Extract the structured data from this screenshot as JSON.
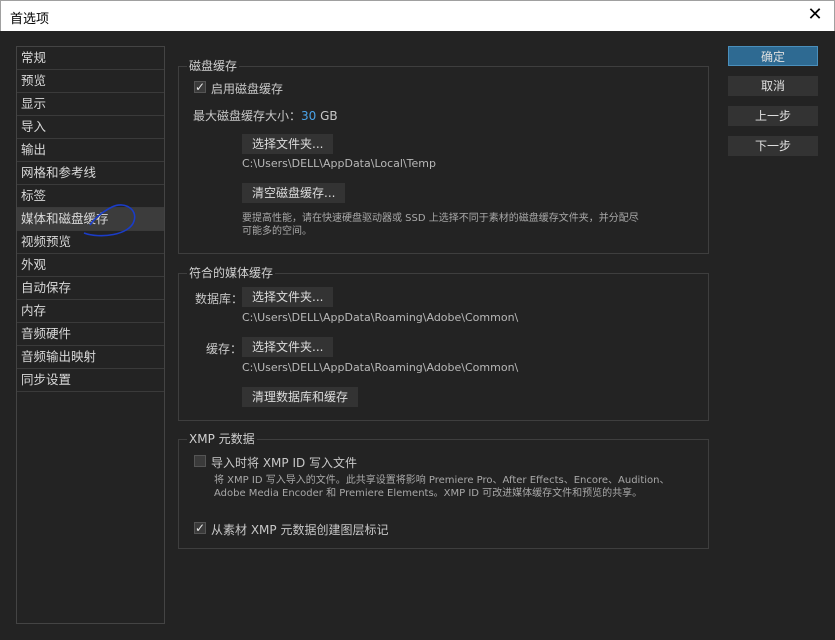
{
  "window": {
    "title": "首选项"
  },
  "sidebar": {
    "items": [
      {
        "label": "常规"
      },
      {
        "label": "预览"
      },
      {
        "label": "显示"
      },
      {
        "label": "导入"
      },
      {
        "label": "输出"
      },
      {
        "label": "网格和参考线"
      },
      {
        "label": "标签"
      },
      {
        "label": "媒体和磁盘缓存"
      },
      {
        "label": "视频预览"
      },
      {
        "label": "外观"
      },
      {
        "label": "自动保存"
      },
      {
        "label": "内存"
      },
      {
        "label": "音频硬件"
      },
      {
        "label": "音频输出映射"
      },
      {
        "label": "同步设置"
      }
    ],
    "selected_index": 7
  },
  "disk_cache": {
    "title": "磁盘缓存",
    "enable_label": "启用磁盘缓存",
    "enabled": true,
    "max_size_label": "最大磁盘缓存大小：",
    "max_size_value": "30",
    "max_size_unit": "GB",
    "choose_folder_label": "选择文件夹...",
    "path": "C:\\Users\\DELL\\AppData\\Local\\Temp",
    "clear_label": "清空磁盘缓存...",
    "note_line1": "要提高性能，请在快速硬盘驱动器或 SSD 上选择不同于素材的磁盘缓存文件夹，并分配尽",
    "note_line2": "可能多的空间。"
  },
  "media_cache": {
    "title": "符合的媒体缓存",
    "database_label": "数据库：",
    "database_button": "选择文件夹...",
    "database_path": "C:\\Users\\DELL\\AppData\\Roaming\\Adobe\\Common\\",
    "cache_label": "缓存：",
    "cache_button": "选择文件夹...",
    "cache_path": "C:\\Users\\DELL\\AppData\\Roaming\\Adobe\\Common\\",
    "clean_label": "清理数据库和缓存"
  },
  "xmp": {
    "title": "XMP 元数据",
    "write_id_label": "导入时将 XMP ID 写入文件",
    "write_id_checked": false,
    "note_line1": "将 XMP ID 写入导入的文件。此共享设置将影响 Premiere Pro、After Effects、Encore、Audition、",
    "note_line2": "Adobe Media Encoder 和 Premiere Elements。XMP ID 可改进媒体缓存文件和预览的共享。",
    "create_markers_label": "从素材 XMP 元数据创建图层标记",
    "create_markers_checked": true
  },
  "buttons": {
    "ok": "确定",
    "cancel": "取消",
    "prev": "上一步",
    "next": "下一步"
  },
  "colors": {
    "accent": "#2e6a92",
    "value_highlight": "#4aa3e8",
    "annotation": "#1a3cc8"
  },
  "icons": {
    "close": "close-icon",
    "check": "checkmark-icon"
  }
}
